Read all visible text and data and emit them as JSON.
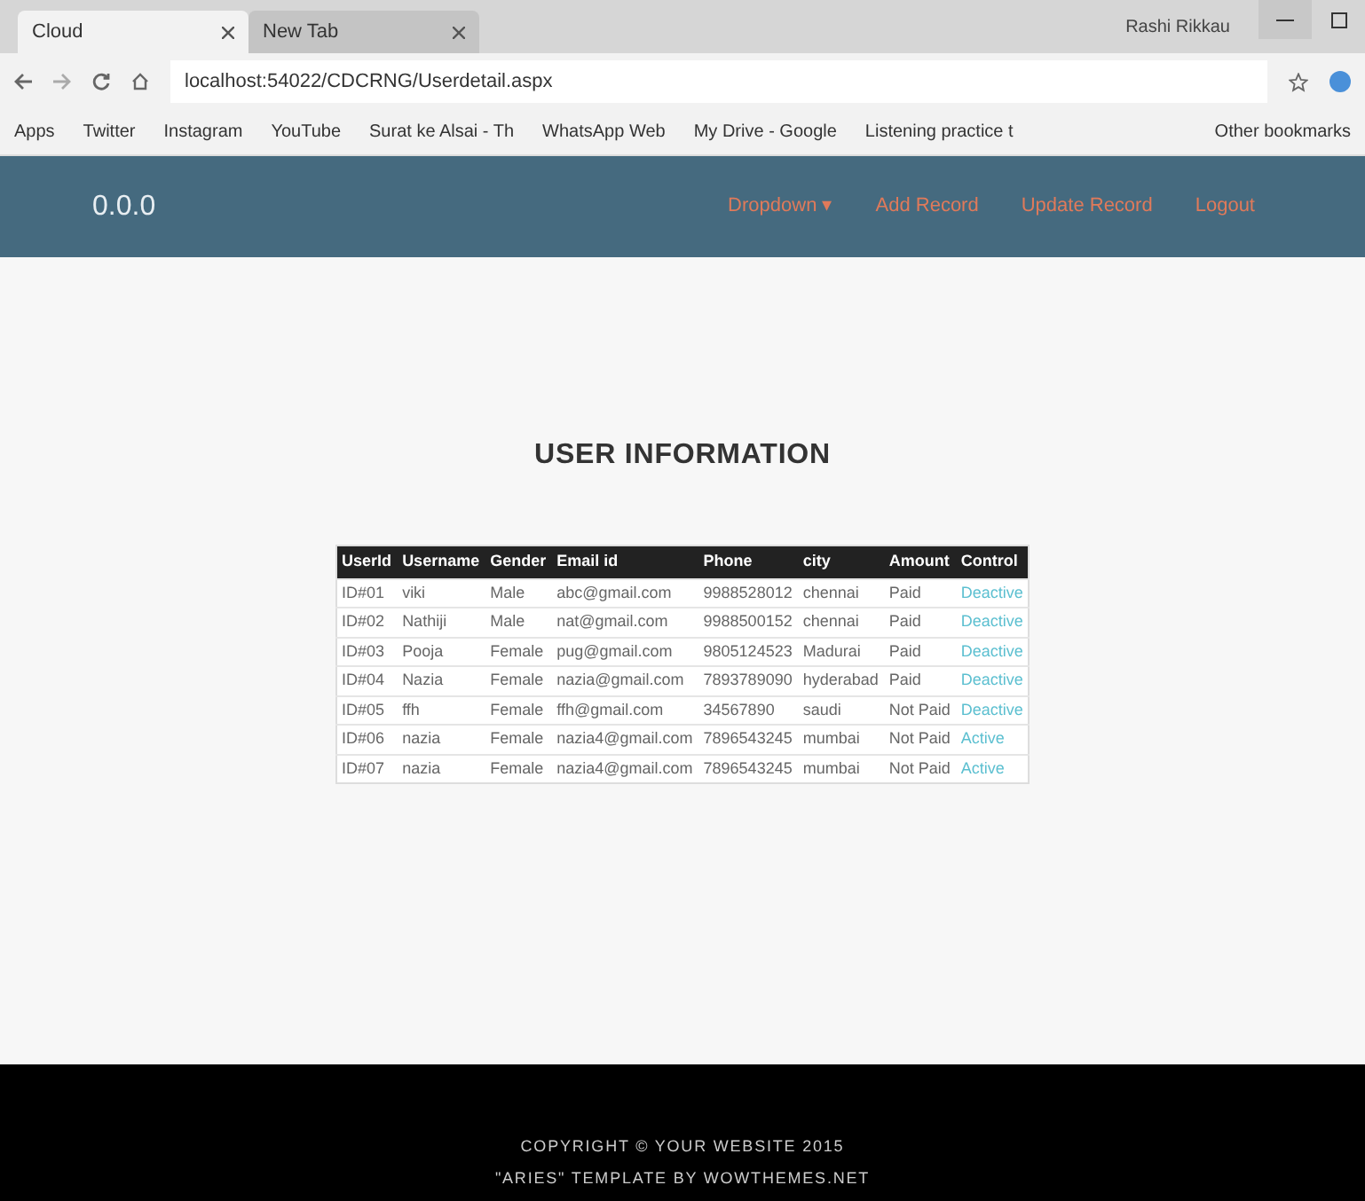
{
  "browser": {
    "tabs": [
      {
        "label": "Cloud",
        "selected": true
      },
      {
        "label": "New Tab",
        "selected": false
      }
    ],
    "profile": "Rashi Rikkau",
    "address": "localhost:54022/CDCRNG/Userdetail.aspx",
    "bookmarks": [
      "Apps",
      "Twitter",
      "Instagram",
      "YouTube",
      "Surat ke Alsai - Th",
      "WhatsApp Web",
      "My Drive - Google",
      "Listening practice t"
    ],
    "other_bookmarks": "Other bookmarks"
  },
  "navbar": {
    "brand": "0.0.0",
    "links": [
      "Dropdown ▾",
      "Add Record",
      "Update Record",
      "Logout"
    ]
  },
  "title": "USER INFORMATION",
  "table": {
    "columns": [
      "UserId",
      "Username",
      "Gender",
      "Email id",
      "Phone",
      "city",
      "Amount",
      "Control"
    ],
    "rows": [
      [
        "ID#01",
        "viki",
        "Male",
        "abc@gmail.com",
        "9988528012",
        "chennai",
        "Paid",
        "Deactive"
      ],
      [
        "ID#02",
        "Nathiji",
        "Male",
        "nat@gmail.com",
        "9988500152",
        "chennai",
        "Paid",
        "Deactive"
      ],
      [
        "ID#03",
        "Pooja",
        "Female",
        "pug@gmail.com",
        "9805124523",
        "Madurai",
        "Paid",
        "Deactive"
      ],
      [
        "ID#04",
        "Nazia",
        "Female",
        "nazia@gmail.com",
        "7893789090",
        "hyderabad",
        "Paid",
        "Deactive"
      ],
      [
        "ID#05",
        "ffh",
        "Female",
        "ffh@gmail.com",
        "34567890",
        "saudi",
        "Not Paid",
        "Deactive"
      ],
      [
        "ID#06",
        "nazia",
        "Female",
        "nazia4@gmail.com",
        "7896543245",
        "mumbai",
        "Not Paid",
        "Active"
      ],
      [
        "ID#07",
        "nazia",
        "Female",
        "nazia4@gmail.com",
        "7896543245",
        "mumbai",
        "Not Paid",
        "Active"
      ]
    ]
  },
  "footer": [
    "COPYRIGHT © YOUR WEBSITE 2015",
    "\"ARIES\" TEMPLATE BY WOWTHEMES.NET"
  ]
}
